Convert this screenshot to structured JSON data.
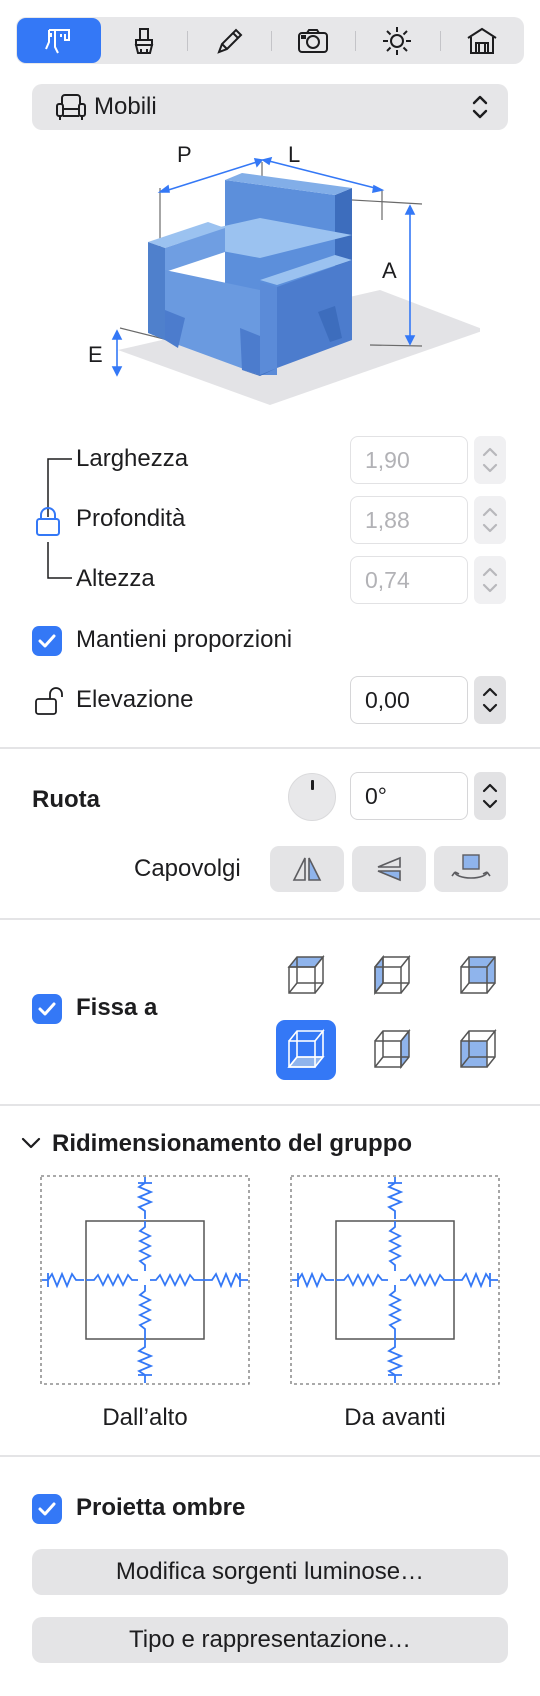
{
  "toolbar": {
    "tabs": [
      {
        "name": "dimensions",
        "icon": "caliper-icon",
        "active": true
      },
      {
        "name": "materials",
        "icon": "brush-icon",
        "active": false
      },
      {
        "name": "edit",
        "icon": "pencil-icon",
        "active": false
      },
      {
        "name": "camera",
        "icon": "camera-icon",
        "active": false
      },
      {
        "name": "light",
        "icon": "sun-icon",
        "active": false
      },
      {
        "name": "building",
        "icon": "house-icon",
        "active": false
      }
    ]
  },
  "category": {
    "label": "Mobili",
    "icon": "armchair-icon"
  },
  "diagram": {
    "label_p": "P",
    "label_l": "L",
    "label_a": "A",
    "label_e": "E"
  },
  "dimensions": {
    "width_label": "Larghezza",
    "width_value": "1,90",
    "depth_label": "Profondità",
    "depth_value": "1,88",
    "height_label": "Altezza",
    "height_value": "0,74",
    "keep_proportions_label": "Mantieni proporzioni",
    "elevation_label": "Elevazione",
    "elevation_value": "0,00"
  },
  "rotate": {
    "label": "Ruota",
    "value": "0°",
    "flip_label": "Capovolgi"
  },
  "anchor": {
    "label": "Fissa a"
  },
  "group_resize": {
    "title": "Ridimensionamento del gruppo",
    "top_caption": "Dall’alto",
    "front_caption": "Da avanti"
  },
  "shadows": {
    "label": "Proietta ombre"
  },
  "buttons": {
    "light_sources": "Modifica sorgenti luminose…",
    "type_repr": "Tipo e rappresentazione…"
  },
  "colors": {
    "accent": "#3478f6",
    "furniture": "#5b8fd9"
  }
}
